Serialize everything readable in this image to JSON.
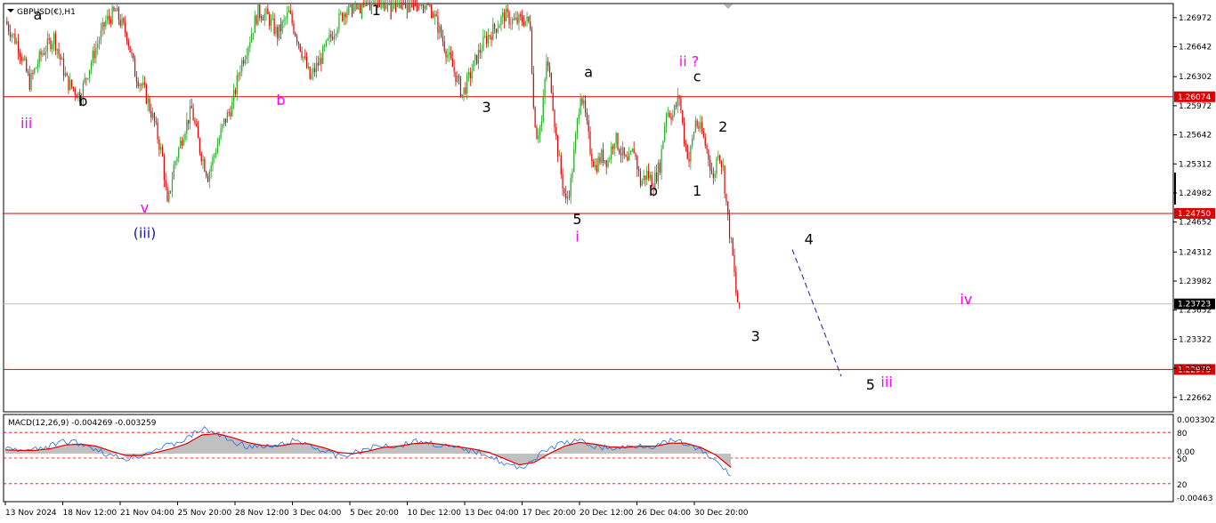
{
  "chart_data": {
    "type": "candlestick",
    "title": "GBPUSD(€),H1",
    "price_axis": {
      "range": [
        1.22498,
        1.27132
      ],
      "ticks": [
        "1.26972",
        "1.26642",
        "1.26302",
        "1.25972",
        "1.25642",
        "1.25312",
        "1.24982",
        "1.24652",
        "1.24312",
        "1.23982",
        "1.23652",
        "1.23322",
        "1.22992",
        "1.22662"
      ]
    },
    "horizontal_levels": [
      {
        "value": 1.26074,
        "label": "1.26074",
        "color": "#e00000"
      },
      {
        "value": 1.2475,
        "label": "1.24750",
        "color": "#e00000"
      },
      {
        "value": 1.22979,
        "label": "1.22979",
        "color": "#e00000"
      },
      {
        "value": 1.23723,
        "label": "1.23723",
        "color": "#000000"
      }
    ],
    "time_axis": [
      "13 Nov 2024",
      "18 Nov 12:00",
      "21 Nov 04:00",
      "25 Nov 20:00",
      "28 Nov 12:00",
      "3 Dec 04:00",
      "5 Dec 20:00",
      "10 Dec 12:00",
      "13 Dec 04:00",
      "17 Dec 20:00",
      "20 Dec 12:00",
      "26 Dec 04:00",
      "30 Dec 20:00"
    ],
    "price_path": [
      {
        "i": 0,
        "p": 1.2693
      },
      {
        "i": 8,
        "p": 1.2666
      },
      {
        "i": 15,
        "p": 1.2623
      },
      {
        "i": 22,
        "p": 1.2655
      },
      {
        "i": 30,
        "p": 1.2675
      },
      {
        "i": 38,
        "p": 1.2625
      },
      {
        "i": 46,
        "p": 1.2608
      },
      {
        "i": 55,
        "p": 1.2658
      },
      {
        "i": 62,
        "p": 1.2693
      },
      {
        "i": 68,
        "p": 1.2704
      },
      {
        "i": 75,
        "p": 1.2678
      },
      {
        "i": 80,
        "p": 1.2635
      },
      {
        "i": 86,
        "p": 1.2613
      },
      {
        "i": 92,
        "p": 1.2578
      },
      {
        "i": 97,
        "p": 1.2538
      },
      {
        "i": 100,
        "p": 1.2482
      },
      {
        "i": 104,
        "p": 1.2528
      },
      {
        "i": 110,
        "p": 1.2568
      },
      {
        "i": 115,
        "p": 1.2593
      },
      {
        "i": 120,
        "p": 1.2548
      },
      {
        "i": 125,
        "p": 1.2518
      },
      {
        "i": 130,
        "p": 1.2548
      },
      {
        "i": 135,
        "p": 1.2578
      },
      {
        "i": 140,
        "p": 1.2598
      },
      {
        "i": 145,
        "p": 1.2642
      },
      {
        "i": 150,
        "p": 1.2668
      },
      {
        "i": 156,
        "p": 1.2705
      },
      {
        "i": 162,
        "p": 1.2698
      },
      {
        "i": 168,
        "p": 1.2678
      },
      {
        "i": 175,
        "p": 1.2702
      },
      {
        "i": 182,
        "p": 1.2665
      },
      {
        "i": 188,
        "p": 1.2628
      },
      {
        "i": 194,
        "p": 1.2648
      },
      {
        "i": 200,
        "p": 1.2672
      },
      {
        "i": 206,
        "p": 1.2695
      },
      {
        "i": 212,
        "p": 1.2712
      },
      {
        "i": 220,
        "p": 1.2725
      },
      {
        "i": 230,
        "p": 1.2735
      },
      {
        "i": 240,
        "p": 1.2738
      },
      {
        "i": 250,
        "p": 1.2732
      },
      {
        "i": 256,
        "p": 1.2718
      },
      {
        "i": 262,
        "p": 1.2712
      },
      {
        "i": 268,
        "p": 1.2682
      },
      {
        "i": 274,
        "p": 1.265
      },
      {
        "i": 278,
        "p": 1.2632
      },
      {
        "i": 282,
        "p": 1.261
      },
      {
        "i": 286,
        "p": 1.2628
      },
      {
        "i": 291,
        "p": 1.2652
      },
      {
        "i": 296,
        "p": 1.2672
      },
      {
        "i": 302,
        "p": 1.2685
      },
      {
        "i": 308,
        "p": 1.27
      },
      {
        "i": 314,
        "p": 1.2692
      },
      {
        "i": 320,
        "p": 1.2695
      },
      {
        "i": 324,
        "p": 1.269
      },
      {
        "i": 326,
        "p": 1.2595
      },
      {
        "i": 328,
        "p": 1.2565
      },
      {
        "i": 331,
        "p": 1.2578
      },
      {
        "i": 334,
        "p": 1.2648
      },
      {
        "i": 337,
        "p": 1.262
      },
      {
        "i": 340,
        "p": 1.256
      },
      {
        "i": 343,
        "p": 1.252
      },
      {
        "i": 346,
        "p": 1.2487
      },
      {
        "i": 349,
        "p": 1.251
      },
      {
        "i": 352,
        "p": 1.256
      },
      {
        "i": 355,
        "p": 1.2614
      },
      {
        "i": 358,
        "p": 1.2585
      },
      {
        "i": 361,
        "p": 1.2548
      },
      {
        "i": 364,
        "p": 1.2528
      },
      {
        "i": 368,
        "p": 1.254
      },
      {
        "i": 372,
        "p": 1.2535
      },
      {
        "i": 376,
        "p": 1.2562
      },
      {
        "i": 380,
        "p": 1.2545
      },
      {
        "i": 384,
        "p": 1.253
      },
      {
        "i": 388,
        "p": 1.2548
      },
      {
        "i": 392,
        "p": 1.251
      },
      {
        "i": 396,
        "p": 1.252
      },
      {
        "i": 400,
        "p": 1.251
      },
      {
        "i": 404,
        "p": 1.253
      },
      {
        "i": 408,
        "p": 1.2592
      },
      {
        "i": 412,
        "p": 1.2587
      },
      {
        "i": 416,
        "p": 1.2608
      },
      {
        "i": 419,
        "p": 1.256
      },
      {
        "i": 422,
        "p": 1.2535
      },
      {
        "i": 426,
        "p": 1.258
      },
      {
        "i": 430,
        "p": 1.2566
      },
      {
        "i": 434,
        "p": 1.254
      },
      {
        "i": 437,
        "p": 1.2512
      },
      {
        "i": 440,
        "p": 1.2548
      },
      {
        "i": 443,
        "p": 1.2525
      },
      {
        "i": 446,
        "p": 1.2468
      },
      {
        "i": 449,
        "p": 1.2425
      },
      {
        "i": 451,
        "p": 1.2385
      },
      {
        "i": 453,
        "p": 1.2365
      }
    ],
    "projection": [
      {
        "label": "4",
        "price": 1.244
      },
      {
        "label": "5",
        "price": 1.228
      }
    ],
    "wave_labels": [
      {
        "text": "a",
        "color": "#000000",
        "price": 1.2695,
        "i": 20
      },
      {
        "text": "b",
        "color": "#000000",
        "price": 1.2597,
        "i": 48
      },
      {
        "text": "iii",
        "color": "#ff00ff",
        "price": 1.2572,
        "i": 13
      },
      {
        "text": "c",
        "color": "#000000",
        "price": 1.273,
        "i": 63
      },
      {
        "text": "v",
        "color": "#ff00ff",
        "price": 1.2476,
        "i": 86
      },
      {
        "text": "(iii)",
        "color": "#1a1aa6",
        "price": 1.2447,
        "i": 86
      },
      {
        "text": "b",
        "color": "#ff00ff",
        "price": 1.2598,
        "i": 170
      },
      {
        "text": "1",
        "color": "#000000",
        "price": 1.27,
        "i": 229
      },
      {
        "text": "3",
        "color": "#000000",
        "price": 1.259,
        "i": 297
      },
      {
        "text": "5",
        "color": "#000000",
        "price": 1.2463,
        "i": 353
      },
      {
        "text": "i",
        "color": "#ff00ff",
        "price": 1.2443,
        "i": 353
      },
      {
        "text": "a",
        "color": "#000000",
        "price": 1.263,
        "i": 360
      },
      {
        "text": "b",
        "color": "#000000",
        "price": 1.2495,
        "i": 400
      },
      {
        "text": "1",
        "color": "#000000",
        "price": 1.2495,
        "i": 427
      },
      {
        "text": "c",
        "color": "#000000",
        "price": 1.2625,
        "i": 427
      },
      {
        "text": "ii ?",
        "color": "#ff00ff",
        "price": 1.2642,
        "i": 422
      },
      {
        "text": "2",
        "color": "#000000",
        "price": 1.2568,
        "i": 443
      },
      {
        "text": "3",
        "color": "#000000",
        "price": 1.233,
        "i": 463
      },
      {
        "text": "4",
        "color": "#000000",
        "price": 1.244,
        "i": 496
      },
      {
        "text": "5",
        "color": "#000000",
        "price": 1.2275,
        "i": 534
      },
      {
        "text": "iii",
        "color": "#ff00ff",
        "price": 1.2278,
        "i": 544
      },
      {
        "text": "iv",
        "color": "#ff00ff",
        "price": 1.2372,
        "i": 593
      }
    ],
    "macd": {
      "label": "MACD(12,26,9) -0.004269 -0.003259",
      "axis_ticks": [
        "0.003302",
        "80",
        "0.00",
        "50",
        "20",
        "-0.00463"
      ],
      "levels": [
        80,
        50,
        20
      ],
      "main_path": [
        0.2,
        0.1,
        0.15,
        0.3,
        0.5,
        0.4,
        0.2,
        -0.1,
        -0.2,
        -0.05,
        0.2,
        0.35,
        0.6,
        1.0,
        0.8,
        0.5,
        0.3,
        0.25,
        0.3,
        0.5,
        0.4,
        0.1,
        -0.1,
        0.0,
        0.2,
        0.35,
        0.3,
        0.5,
        0.45,
        0.3,
        0.2,
        0.1,
        -0.05,
        -0.4,
        -0.6,
        -0.2,
        0.2,
        0.45,
        0.5,
        0.3,
        0.2,
        0.25,
        0.35,
        0.3,
        0.5,
        0.4,
        0.1,
        -0.3,
        -0.9
      ],
      "signal_path": [
        0.15,
        0.13,
        0.13,
        0.2,
        0.35,
        0.38,
        0.3,
        0.1,
        -0.08,
        -0.08,
        0.05,
        0.2,
        0.4,
        0.75,
        0.8,
        0.65,
        0.45,
        0.33,
        0.3,
        0.4,
        0.4,
        0.25,
        0.05,
        0.0,
        0.1,
        0.25,
        0.3,
        0.4,
        0.43,
        0.36,
        0.27,
        0.18,
        0.05,
        -0.2,
        -0.45,
        -0.35,
        0.0,
        0.3,
        0.45,
        0.38,
        0.27,
        0.25,
        0.3,
        0.3,
        0.42,
        0.42,
        0.25,
        -0.05,
        -0.55
      ]
    }
  }
}
